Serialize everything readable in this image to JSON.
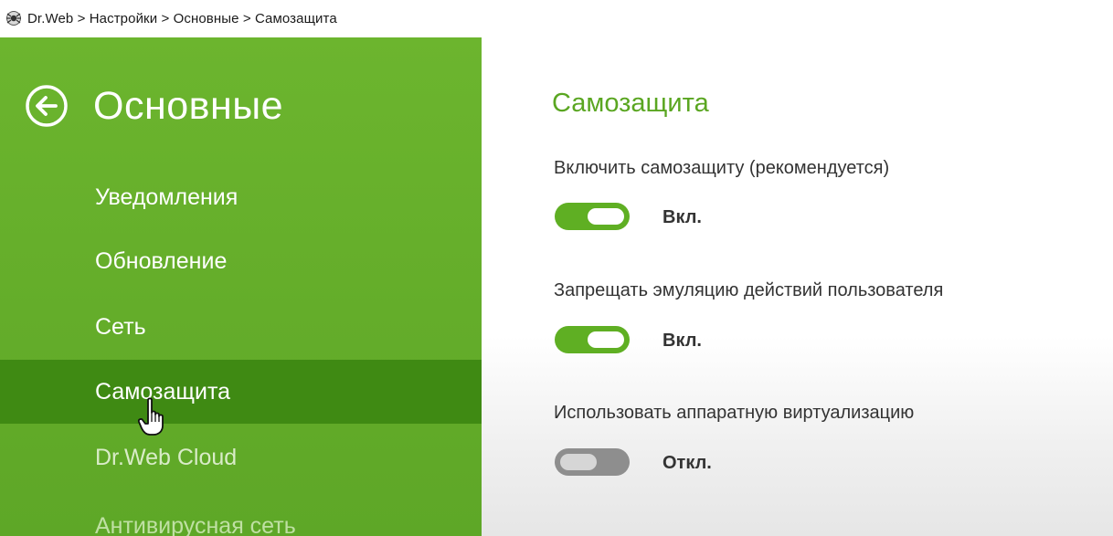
{
  "window": {
    "app_icon": "drweb-spider-icon",
    "breadcrumb": "Dr.Web > Настройки > Основные > Самозащита"
  },
  "sidebar": {
    "back_icon": "back-arrow-circle-icon",
    "title": "Основные",
    "items": [
      {
        "label": "Уведомления",
        "active": false
      },
      {
        "label": "Обновление",
        "active": false
      },
      {
        "label": "Сеть",
        "active": false
      },
      {
        "label": "Самозащита",
        "active": true
      },
      {
        "label": "Dr.Web Cloud",
        "active": false
      },
      {
        "label": "Антивирусная сеть",
        "active": false
      }
    ]
  },
  "main": {
    "title": "Самозащита",
    "settings": [
      {
        "label": "Включить самозащиту (рекомендуется)",
        "state": "Вкл.",
        "on": true
      },
      {
        "label": "Запрещать эмуляцию действий пользователя",
        "state": "Вкл.",
        "on": true
      },
      {
        "label": "Использовать аппаратную виртуализацию",
        "state": "Откл.",
        "on": false
      }
    ]
  },
  "colors": {
    "sidebar_green": "#6cb52e",
    "active_item": "#3f8a13",
    "accent_title": "#5aa621",
    "toggle_on": "#5faf23",
    "toggle_off": "#8e8e8e"
  },
  "cursor_icon": "hand-pointer-icon"
}
